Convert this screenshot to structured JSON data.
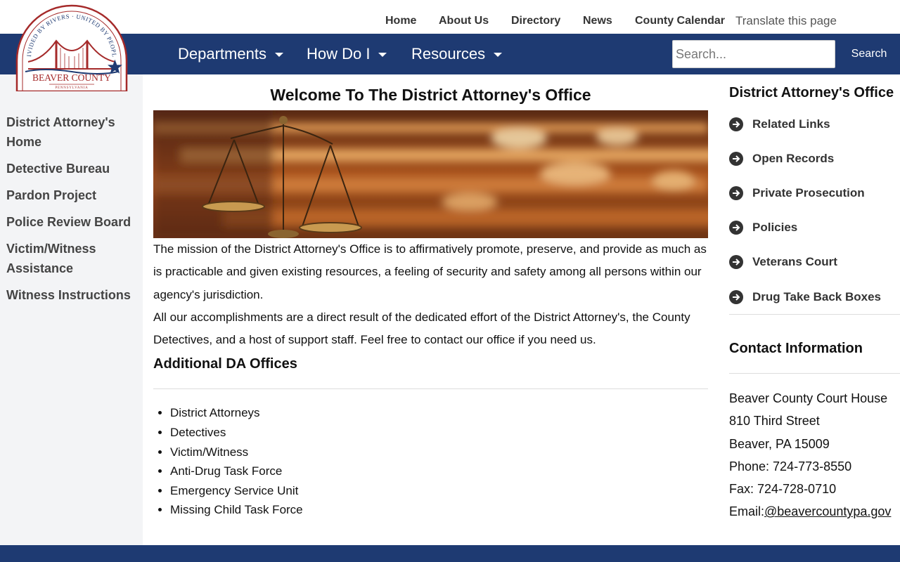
{
  "top_links": [
    {
      "label": "Home"
    },
    {
      "label": "About Us"
    },
    {
      "label": "Directory"
    },
    {
      "label": "News"
    },
    {
      "label": "County Calendar"
    }
  ],
  "translate_label": "Translate this page",
  "logo": {
    "arc_text": "DIVIDED BY RIVERS · UNITED BY PEOPLE",
    "name": "BEAVER COUNTY",
    "state": "PENNSYLVANIA"
  },
  "nav": {
    "menus": [
      {
        "label": "Departments"
      },
      {
        "label": "How Do I"
      },
      {
        "label": "Resources"
      }
    ],
    "search_placeholder": "Search...",
    "search_button": "Search"
  },
  "sidebar": {
    "items": [
      {
        "label": "District Attorney's Home"
      },
      {
        "label": "Detective Bureau"
      },
      {
        "label": "Pardon Project"
      },
      {
        "label": "Police Review Board"
      },
      {
        "label": "Victim/Witness Assistance"
      },
      {
        "label": "Witness Instructions"
      }
    ]
  },
  "main": {
    "title": "Welcome To The District Attorney's Office",
    "paragraph1": "The mission of the District Attorney's Office is to affirmatively promote, preserve, and provide as much as is practicable and given existing resources, a feeling of security and safety among all persons within our agency's jurisdiction.",
    "paragraph2": "All our accomplishments are a direct result of the dedicated effort of the District Attorney's, the County Detectives, and a host of support staff. Feel free to contact our office if you need us.",
    "additional_heading": "Additional DA Offices",
    "offices": [
      "District Attorneys",
      "Detectives",
      "Victim/Witness",
      "Anti-Drug Task Force",
      "Emergency Service Unit",
      "Missing Child Task Force"
    ]
  },
  "right": {
    "title": "District Attorney's Office",
    "links": [
      {
        "label": "Related Links"
      },
      {
        "label": "Open Records"
      },
      {
        "label": "Private Prosecution"
      },
      {
        "label": "Policies"
      },
      {
        "label": "Veterans Court"
      },
      {
        "label": "Drug Take Back Boxes"
      }
    ],
    "contact_title": "Contact Information",
    "contact": {
      "line1": "Beaver County Court House",
      "line2": "810 Third Street",
      "line3": "Beaver, PA 15009",
      "phone": "Phone: 724-773-8550",
      "fax": "Fax: 724-728-0710",
      "email_prefix": "Email:",
      "email_link": "@beavercountypa.gov"
    }
  },
  "colors": {
    "nav_blue": "#1e3a72",
    "sidebar_gray": "#f3f4f6",
    "logo_red": "#a52a2a"
  }
}
